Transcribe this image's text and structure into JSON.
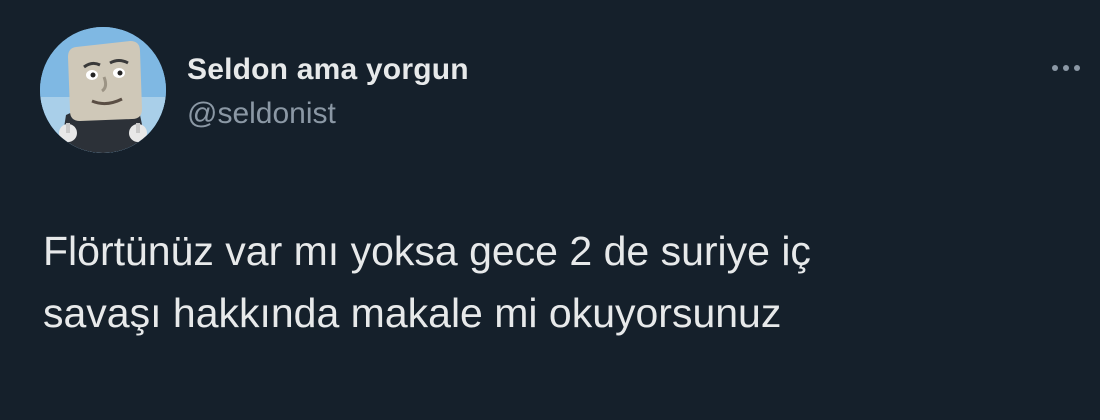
{
  "author": {
    "display_name": "Seldon ama yorgun",
    "handle": "@seldonist"
  },
  "icons": {
    "avatar": "profile-avatar",
    "more": "more-options-icon"
  },
  "tweet": {
    "lines": [
      "Flörtünüz var mı yoksa gece 2 de suriye iç",
      "savaşı hakkında makale mi okuyorsunuz"
    ]
  },
  "colors": {
    "background": "#15202b",
    "primary_text": "#e7e9ea",
    "secondary_text": "#8b98a5"
  }
}
